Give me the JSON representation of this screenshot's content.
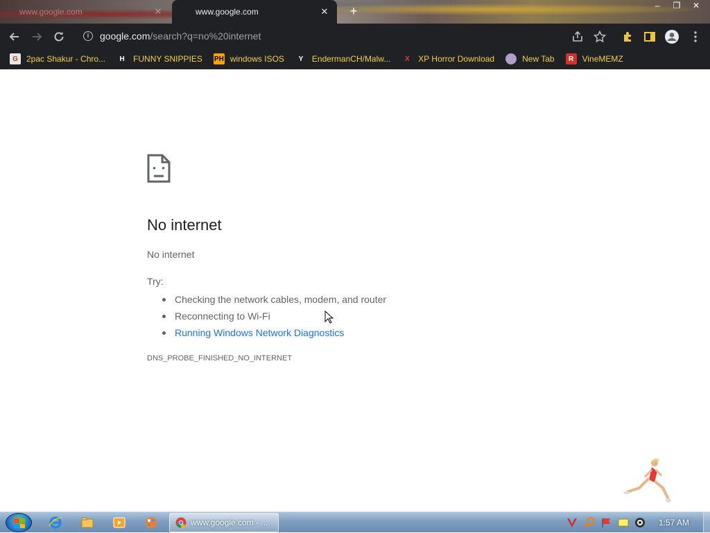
{
  "browser": {
    "tabs": [
      {
        "title": "www.google.com",
        "active": false
      },
      {
        "title": "www.google.com",
        "active": true
      }
    ],
    "new_tab_symbol": "+",
    "window_buttons": [
      "–",
      "❐",
      "✕"
    ],
    "url_domain": "google.com",
    "url_path": "/search?q=no%20internet",
    "toolbar_icons": [
      "back-icon",
      "forward-icon",
      "reload-icon",
      "site-info-icon",
      "share-icon",
      "star-icon",
      "extensions-icon",
      "side-panel-icon",
      "profile-icon",
      "menu-icon"
    ]
  },
  "bookmarks": [
    {
      "label": "2pac Shakur - Chro...",
      "icon": "G",
      "icon_bg": "#e8e8e8",
      "icon_fg": "#c0392b"
    },
    {
      "label": "FUNNY SNIPPIES",
      "icon": "H",
      "icon_bg": "#202124",
      "icon_fg": "#ffffff"
    },
    {
      "label": "windows ISOS",
      "icon": "PH",
      "icon_bg": "#f7a400",
      "icon_fg": "#000000"
    },
    {
      "label": "EndermanCH/Malw...",
      "icon": "Y",
      "icon_bg": "#202124",
      "icon_fg": "#ffffff"
    },
    {
      "label": "XP Horror Download",
      "icon": "X",
      "icon_bg": "#202124",
      "icon_fg": "#e53935"
    },
    {
      "label": "New Tab",
      "icon": "",
      "icon_bg": "#b0a0c8",
      "icon_fg": "#ffffff"
    },
    {
      "label": "VineMEMZ",
      "icon": "R",
      "icon_bg": "#d32f2f",
      "icon_fg": "#ffffff"
    }
  ],
  "page": {
    "heading": "No internet",
    "subtitle": "No internet",
    "try_label": "Try:",
    "suggestions": [
      "Checking the network cables, modem, and router",
      "Reconnecting to Wi-Fi",
      "Running Windows Network Diagnostics"
    ],
    "error_code": "DNS_PROBE_FINISHED_NO_INTERNET"
  },
  "taskbar": {
    "active_item": "www.google.com - ...",
    "clock": "1:57 AM",
    "pinned": [
      "internet-explorer-icon",
      "file-explorer-icon",
      "media-player-icon",
      "paint-icon"
    ],
    "tray_icons": [
      "antivirus-icon",
      "search-tray-icon",
      "flag-icon",
      "network-icon",
      "volume-icon"
    ]
  },
  "colors": {
    "chrome_dark": "#202124",
    "bookmark_text": "#f0d050",
    "link": "#1a73e8",
    "text_secondary": "#5f6368"
  }
}
